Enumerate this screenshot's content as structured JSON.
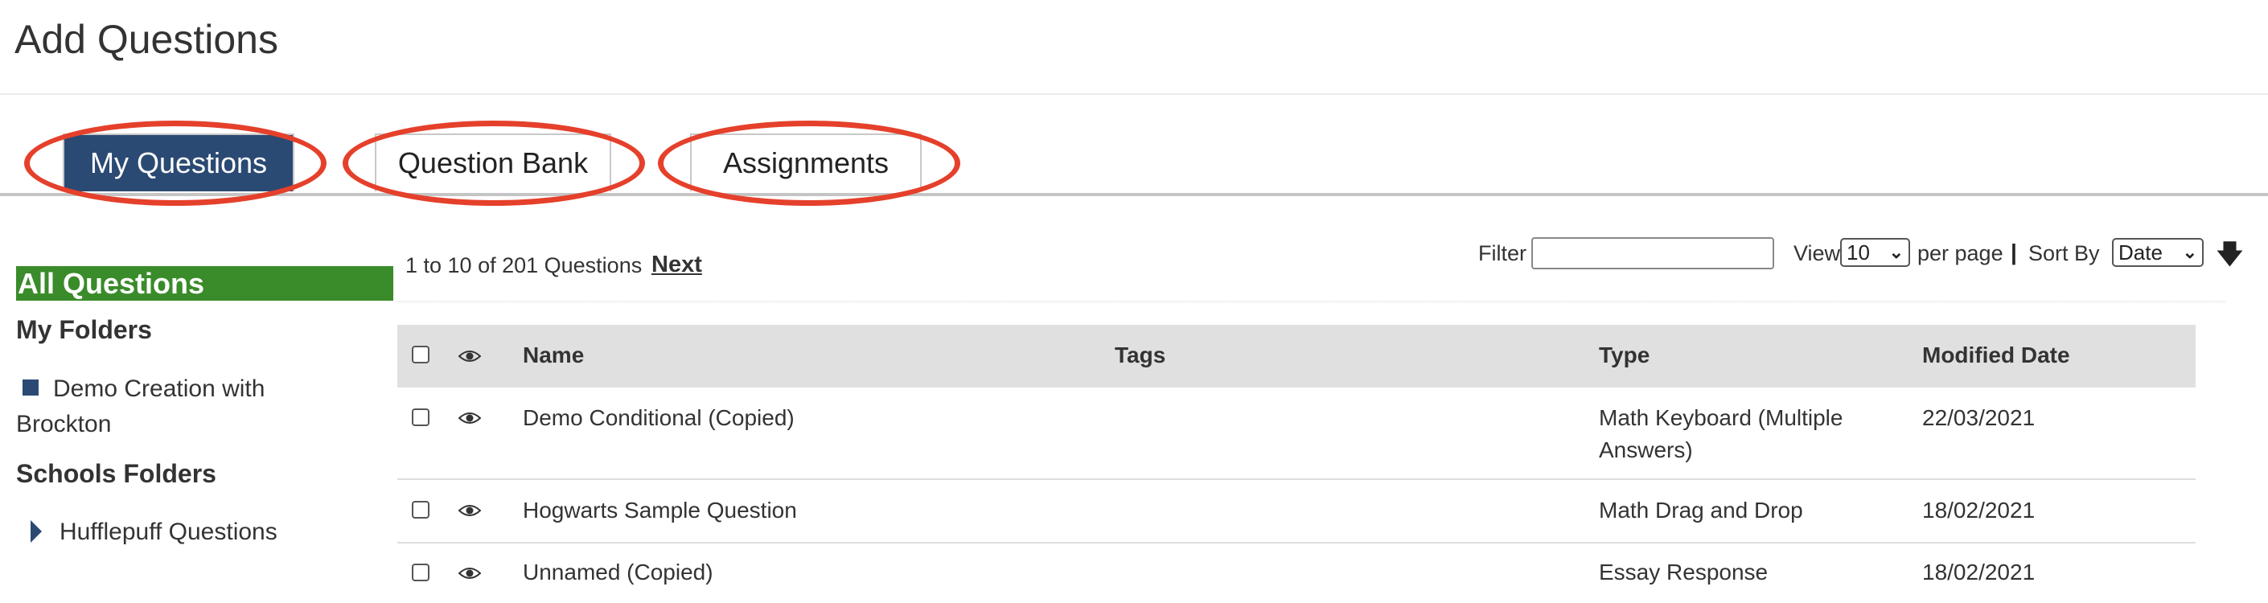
{
  "page": {
    "title": "Add Questions"
  },
  "tabs": [
    {
      "label": "My Questions",
      "active": true
    },
    {
      "label": "Question Bank",
      "active": false
    },
    {
      "label": "Assignments",
      "active": false
    }
  ],
  "sidebar": {
    "all_questions": "All Questions",
    "my_folders_heading": "My Folders",
    "my_folders": [
      {
        "label": "Demo Creation with Brockton",
        "icon": "folder-square-icon"
      }
    ],
    "schools_folders_heading": "Schools Folders",
    "schools_folders": [
      {
        "label": "Hufflepuff Questions",
        "icon": "caret-right-icon"
      }
    ]
  },
  "toolbar": {
    "range_text": "1 to 10 of 201 Questions",
    "next_label": "Next",
    "filter_label": "Filter",
    "filter_value": "",
    "view_label": "View",
    "per_page_value": "10",
    "per_page_label": "per page",
    "separator": "|",
    "sort_by_label": "Sort By",
    "sort_by_value": "Date",
    "sort_direction_icon": "arrow-down-icon"
  },
  "table": {
    "columns": [
      "Name",
      "Tags",
      "Type",
      "Modified Date"
    ],
    "rows": [
      {
        "name": "Demo Conditional (Copied)",
        "tags": "",
        "type_line1": "Math Keyboard (Multiple",
        "type_line2": "Answers)",
        "modified": "22/03/2021"
      },
      {
        "name": "Hogwarts Sample Question",
        "tags": "",
        "type_line1": "Math Drag and Drop",
        "type_line2": "",
        "modified": "18/02/2021"
      },
      {
        "name": "Unnamed (Copied)",
        "tags": "",
        "type_line1": "Essay Response",
        "type_line2": "",
        "modified": "18/02/2021"
      }
    ]
  },
  "colors": {
    "accent_navy": "#2b4a73",
    "all_questions_green": "#3a8b2a",
    "highlight_red": "#e5402b",
    "header_gray": "#e0e0e0"
  }
}
